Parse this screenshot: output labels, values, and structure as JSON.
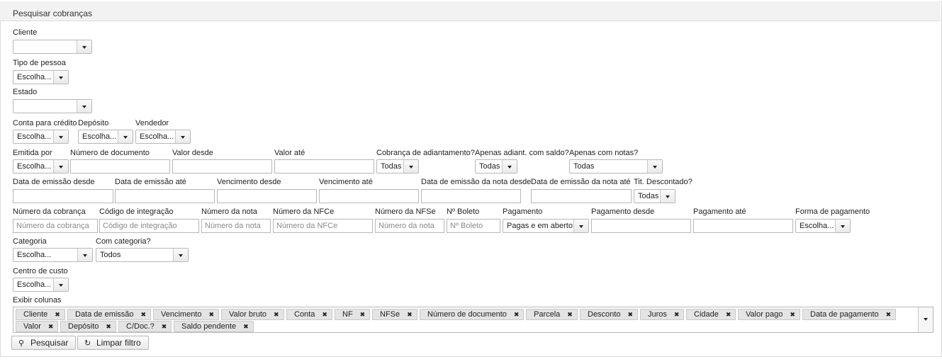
{
  "panel": {
    "title": "Pesquisar cobranças"
  },
  "cliente": {
    "label": "Cliente",
    "value": ""
  },
  "tipo_pessoa": {
    "label": "Tipo de pessoa",
    "value": "Escolha..."
  },
  "estado": {
    "label": "Estado",
    "value": ""
  },
  "conta_credito": {
    "label": "Conta para crédito",
    "value": "Escolha..."
  },
  "deposito": {
    "label": "Depósito",
    "value": "Escolha..."
  },
  "vendedor": {
    "label": "Vendedor",
    "value": "Escolha..."
  },
  "emitida_por": {
    "label": "Emitida por",
    "value": "Escolha..."
  },
  "numero_documento": {
    "label": "Número de documento",
    "value": ""
  },
  "valor_desde": {
    "label": "Valor desde",
    "value": ""
  },
  "valor_ate": {
    "label": "Valor até",
    "value": ""
  },
  "cobranca_adiantamento": {
    "label": "Cobrança de adiantamento?",
    "value": "Todas"
  },
  "apenas_adiant_saldo": {
    "label": "Apenas adiant. com saldo?",
    "value": "Todas"
  },
  "apenas_notas": {
    "label": "Apenas com notas?",
    "value": "Todas"
  },
  "data_emissao_desde": {
    "label": "Data de emissão desde",
    "value": ""
  },
  "data_emissao_ate": {
    "label": "Data de emissão até",
    "value": ""
  },
  "vencimento_desde": {
    "label": "Vencimento desde",
    "value": ""
  },
  "vencimento_ate": {
    "label": "Vencimento até",
    "value": ""
  },
  "data_emissao_nota_desde": {
    "label": "Data de emissão da nota desde",
    "value": ""
  },
  "data_emissao_nota_ate": {
    "label": "Data de emissão da nota até",
    "value": ""
  },
  "tit_descontado": {
    "label": "Tit. Descontado?",
    "value": "Todas"
  },
  "numero_cobranca": {
    "label": "Número da cobrança",
    "placeholder": "Número da cobrança"
  },
  "codigo_integracao": {
    "label": "Código de integração",
    "placeholder": "Código de integração"
  },
  "numero_nota": {
    "label": "Número da nota",
    "placeholder": "Número da nota"
  },
  "numero_nfce": {
    "label": "Número da NFCe",
    "placeholder": "Número da NFCe"
  },
  "numero_nfse": {
    "label": "Número da NFSe",
    "placeholder": "Número da nota"
  },
  "n_boleto": {
    "label": "Nº Boleto",
    "placeholder": "Nº Boleto"
  },
  "pagamento": {
    "label": "Pagamento",
    "value": "Pagas e em aberto"
  },
  "pagamento_desde": {
    "label": "Pagamento desde",
    "value": ""
  },
  "pagamento_ate": {
    "label": "Pagamento até",
    "value": ""
  },
  "forma_pagamento": {
    "label": "Forma de pagamento",
    "value": "Escolha..."
  },
  "categoria": {
    "label": "Categoria",
    "value": "Escolha..."
  },
  "com_categoria": {
    "label": "Com categoria?",
    "value": "Todos"
  },
  "centro_custo": {
    "label": "Centro de custo",
    "value": "Escolha..."
  },
  "exibir_colunas": {
    "label": "Exibir colunas",
    "remove_glyph": "✖",
    "tags": [
      "Cliente",
      "Data de emissão",
      "Vencimento",
      "Valor bruto",
      "Conta",
      "NF",
      "NFSe",
      "Número de documento",
      "Parcela",
      "Desconto",
      "Juros",
      "Cidade",
      "Valor pago",
      "Data de pagamento",
      "Valor",
      "Depósito",
      "C/Doc.?",
      "Saldo pendente"
    ]
  },
  "buttons": {
    "search": "Pesquisar",
    "clear": "Limpar filtro",
    "search_icon": "magnifier-icon",
    "clear_icon": "refresh-icon"
  }
}
